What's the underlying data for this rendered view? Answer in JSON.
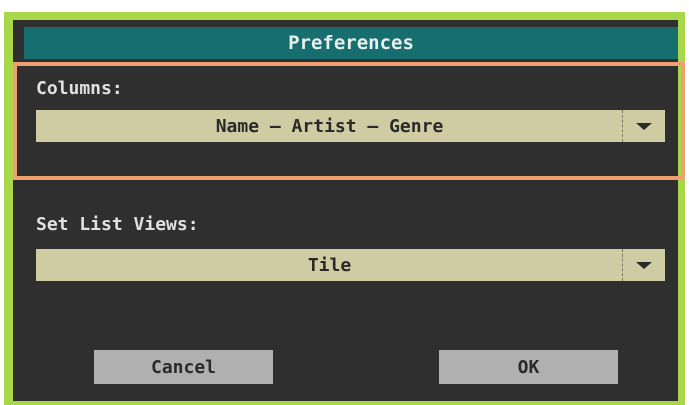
{
  "dialog": {
    "title": "Preferences",
    "columns": {
      "label": "Columns:",
      "value": "Name – Artist – Genre"
    },
    "set_list_views": {
      "label": "Set List Views:",
      "value": "Tile"
    },
    "buttons": {
      "cancel": "Cancel",
      "ok": "OK"
    }
  },
  "colors": {
    "frame": "#a8d84a",
    "background": "#2f2f2f",
    "titlebar": "#176e6e",
    "highlight": "#f0a070",
    "select": "#cfcca3",
    "button": "#b0b0b0"
  }
}
